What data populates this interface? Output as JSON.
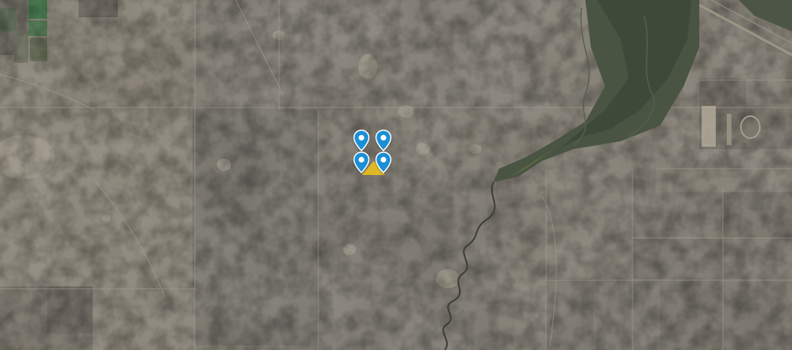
{
  "map": {
    "view": "satellite",
    "colors": {
      "ground": "#7c776d",
      "ground_dark": "#6e6a62",
      "ground_light": "#8b867b",
      "river": "#3d4a3a",
      "river_veg": "#4f5e43",
      "field_green": "#2f6d3a",
      "parcel": "#f0c419",
      "pin": "#1a8fd6",
      "road": "#b7b0a0"
    },
    "parcel": {
      "label": "",
      "color": "#f0c419"
    },
    "markers": [
      {
        "id": "marker-1",
        "icon": "map-pin-icon",
        "color": "#1a8fd6"
      },
      {
        "id": "marker-2",
        "icon": "map-pin-icon",
        "color": "#1a8fd6"
      },
      {
        "id": "marker-3",
        "icon": "map-pin-icon",
        "color": "#1a8fd6"
      },
      {
        "id": "marker-4",
        "icon": "map-pin-icon",
        "color": "#1a8fd6"
      }
    ]
  }
}
